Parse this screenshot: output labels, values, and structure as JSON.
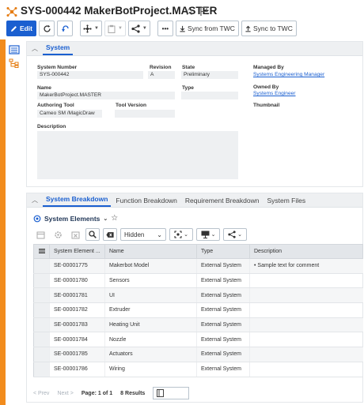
{
  "header": {
    "title": "SYS-000442 MakerBotProject.MASTER",
    "icons": {
      "system": "system-node-icon",
      "star": "star-outline-icon",
      "flag": "flag-icon"
    }
  },
  "toolbar": {
    "edit_label": "Edit",
    "sync_from_label": "Sync from TWC",
    "sync_to_label": "Sync to TWC",
    "more_label": "•••"
  },
  "system_panel": {
    "tab_label": "System",
    "fields": {
      "system_number": {
        "label": "System Number",
        "value": "SYS-000442"
      },
      "revision": {
        "label": "Revision",
        "value": "A"
      },
      "state": {
        "label": "State",
        "value": "Preliminary"
      },
      "managed_by": {
        "label": "Managed By",
        "value": "Systems Engineering Manager"
      },
      "name": {
        "label": "Name",
        "value": "MakerBotProject.MASTER"
      },
      "type": {
        "label": "Type",
        "value": ""
      },
      "owned_by": {
        "label": "Owned By",
        "value": "Systems Engineer"
      },
      "authoring_tool": {
        "label": "Authoring Tool",
        "value": "Cameo SM /MagicDraw"
      },
      "tool_version": {
        "label": "Tool Version",
        "value": ""
      },
      "thumbnail": {
        "label": "Thumbnail"
      },
      "description": {
        "label": "Description",
        "value": ""
      }
    }
  },
  "breakdown_panel": {
    "tabs": [
      {
        "label": "System Breakdown",
        "active": true
      },
      {
        "label": "Function Breakdown",
        "active": false
      },
      {
        "label": "Requirement Breakdown",
        "active": false
      },
      {
        "label": "System Files",
        "active": false
      }
    ],
    "section_title": "System Elements",
    "filter_value": "Hidden",
    "table": {
      "columns": [
        "System Element ...",
        "Name",
        "Type",
        "Description"
      ],
      "rows": [
        {
          "id": "SE-00001775",
          "name": "Makerbot Model",
          "type": "External System",
          "description": "• Sample text for comment"
        },
        {
          "id": "SE-00001780",
          "name": "Sensors",
          "type": "External System",
          "description": ""
        },
        {
          "id": "SE-00001781",
          "name": "UI",
          "type": "External System",
          "description": ""
        },
        {
          "id": "SE-00001782",
          "name": "Extruder",
          "type": "External System",
          "description": ""
        },
        {
          "id": "SE-00001783",
          "name": "Heating Unit",
          "type": "External System",
          "description": ""
        },
        {
          "id": "SE-00001784",
          "name": "Nozzle",
          "type": "External System",
          "description": ""
        },
        {
          "id": "SE-00001785",
          "name": "Actuators",
          "type": "External System",
          "description": ""
        },
        {
          "id": "SE-00001786",
          "name": "Wiring",
          "type": "External System",
          "description": ""
        }
      ]
    },
    "pager": {
      "prev_label": "< Prev",
      "next_label": "Next >",
      "page_text": "Page: 1 of 1",
      "results_text": "8 Results"
    }
  },
  "colors": {
    "accent": "#1a5fd0",
    "rail": "#f28c1d",
    "label": "#1f3556"
  }
}
